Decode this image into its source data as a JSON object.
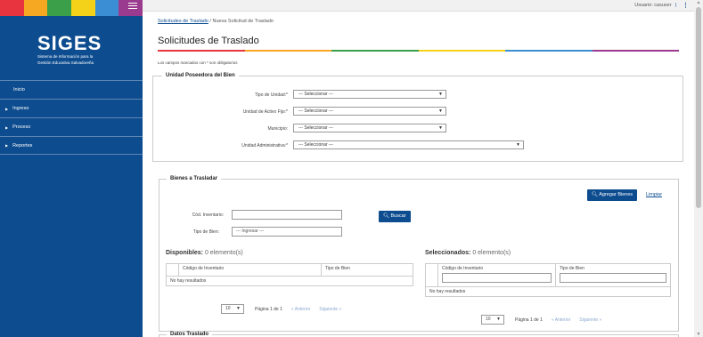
{
  "sidebar": {
    "stripe_colors": [
      "#e7343f",
      "#f7a823",
      "#3a9f48",
      "#f5d21a",
      "#3b8ed4",
      "#9b3b8f"
    ],
    "logo_title": "SIGES",
    "logo_line1": "Sistema de Información para la",
    "logo_line2": "Gestión Educativa Salvadoreña",
    "items": [
      {
        "label": "Inicio"
      },
      {
        "label": "Ingreso"
      },
      {
        "label": "Proceso"
      },
      {
        "label": "Reportes"
      }
    ]
  },
  "topbar": {
    "user_text": "Usuario: casuser",
    "separator": "|"
  },
  "breadcrumb": {
    "parent": "Solicitudes de Traslado",
    "divider": "/",
    "current": "Nueva Solicitud de Traslado"
  },
  "page_title": "Solicitudes de Traslado",
  "required_note": "Los campos marcados con * son obligatorios",
  "unidad": {
    "legend": "Unidad Poseedora del Bien",
    "fields": [
      {
        "label": "Tipo de Unidad:*",
        "value": "--- Seleccionar ---"
      },
      {
        "label": "Unidad de Activo Fijo:*",
        "value": "--- Seleccionar ---"
      },
      {
        "label": "Municipio:",
        "value": "--- Seleccionar ---"
      },
      {
        "label": "Unidad Administrativa:*",
        "value": "--- Seleccionar ---"
      }
    ]
  },
  "bienes": {
    "legend": "Bienes a Trasladar",
    "add_button": "Agregar Bienes",
    "clear_link": "Limpiar",
    "codigo_label": "Cód. Inventario:",
    "codigo_value": "",
    "tipo_label": "Tipo de Bien:",
    "tipo_placeholder": "--- Ingresar ---",
    "search_button": "Buscar",
    "disponibles": {
      "title": "Disponibles:",
      "count": "0 elemento(s)",
      "columns": [
        "Código de Inventario",
        "Tipo de Bien"
      ],
      "empty": "No hay resultados"
    },
    "seleccionados": {
      "title": "Seleccionados:",
      "count": "0 elemento(s)",
      "columns": [
        "Código de Inventario",
        "Tipo de Bien"
      ],
      "empty": "No hay resultados"
    },
    "pager": {
      "size": "10",
      "page_text": "Página 1 de 1",
      "prev": "« Anterior",
      "next": "Siguiente »"
    }
  },
  "datos": {
    "legend": "Datos Traslado"
  }
}
